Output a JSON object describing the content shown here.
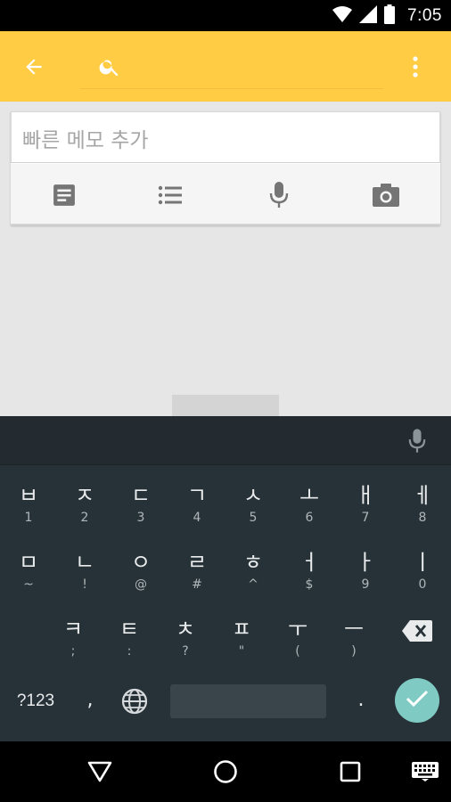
{
  "status_bar": {
    "time": "7:05",
    "icons": [
      "wifi-icon",
      "signal-icon",
      "battery-icon"
    ]
  },
  "app_bar": {
    "background": "#ffcc44",
    "icons": [
      "back-arrow-icon",
      "search-icon",
      "more-vert-icon"
    ]
  },
  "note": {
    "placeholder": "빠른 메모 추가",
    "actions": [
      {
        "name": "new-note",
        "icon": "note-text-icon"
      },
      {
        "name": "new-list",
        "icon": "list-icon"
      },
      {
        "name": "voice-note",
        "icon": "mic-icon"
      },
      {
        "name": "photo-note",
        "icon": "camera-icon"
      }
    ]
  },
  "keyboard": {
    "row1": [
      {
        "main": "ㅂ",
        "sub": "1"
      },
      {
        "main": "ㅈ",
        "sub": "2"
      },
      {
        "main": "ㄷ",
        "sub": "3"
      },
      {
        "main": "ㄱ",
        "sub": "4"
      },
      {
        "main": "ㅅ",
        "sub": "5"
      },
      {
        "main": "ㅗ",
        "sub": "6"
      },
      {
        "main": "ㅐ",
        "sub": "7"
      },
      {
        "main": "ㅔ",
        "sub": "8"
      }
    ],
    "row2": [
      {
        "main": "ㅁ",
        "sub": "~"
      },
      {
        "main": "ㄴ",
        "sub": "!"
      },
      {
        "main": "ㅇ",
        "sub": "@"
      },
      {
        "main": "ㄹ",
        "sub": "#"
      },
      {
        "main": "ㅎ",
        "sub": "^"
      },
      {
        "main": "ㅓ",
        "sub": "$"
      },
      {
        "main": "ㅏ",
        "sub": "9"
      },
      {
        "main": "ㅣ",
        "sub": "0"
      }
    ],
    "row3": [
      {
        "main": "ㅋ",
        "sub": ";"
      },
      {
        "main": "ㅌ",
        "sub": ":"
      },
      {
        "main": "ㅊ",
        "sub": "?"
      },
      {
        "main": "ㅍ",
        "sub": "\""
      },
      {
        "main": "ㅜ",
        "sub": "("
      },
      {
        "main": "ㅡ",
        "sub": ")"
      }
    ],
    "symbols_label": "?123",
    "comma": ",",
    "period": ".",
    "enter_color": "#7fcbc4"
  },
  "nav_bar": {
    "icons": [
      "back-triangle-icon",
      "home-circle-icon",
      "recents-square-icon",
      "keyboard-icon"
    ]
  }
}
